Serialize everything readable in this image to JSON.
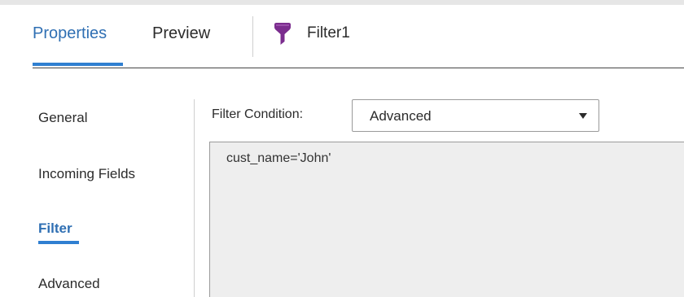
{
  "header": {
    "tabs": [
      {
        "label": "Properties",
        "active": true
      },
      {
        "label": "Preview",
        "active": false
      }
    ],
    "object_title": "Filter1",
    "object_icon": "filter-funnel-icon"
  },
  "sidebar": {
    "items": [
      {
        "label": "General",
        "active": false
      },
      {
        "label": "Incoming Fields",
        "active": false
      },
      {
        "label": "Filter",
        "active": true
      },
      {
        "label": "Advanced",
        "active": false
      }
    ]
  },
  "filter_panel": {
    "condition_label": "Filter Condition:",
    "condition_type": "Advanced",
    "condition_expression": "cust_name='John'"
  },
  "colors": {
    "accent": "#2f7fd1",
    "active_text": "#2f6fb3",
    "filter_icon": "#7b2d8e",
    "editor_background": "#eeeeee"
  }
}
